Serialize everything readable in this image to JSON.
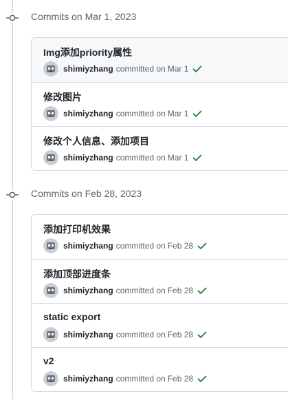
{
  "groups": [
    {
      "title": "Commits on Mar 1, 2023",
      "commits": [
        {
          "title": "Img添加priority属性",
          "author": "shimiyzhang",
          "verb": "committed on",
          "date": "Mar 1"
        },
        {
          "title": "修改图片",
          "author": "shimiyzhang",
          "verb": "committed on",
          "date": "Mar 1"
        },
        {
          "title": "修改个人信息、添加项目",
          "author": "shimiyzhang",
          "verb": "committed on",
          "date": "Mar 1"
        }
      ]
    },
    {
      "title": "Commits on Feb 28, 2023",
      "commits": [
        {
          "title": "添加打印机效果",
          "author": "shimiyzhang",
          "verb": "committed on",
          "date": "Feb 28"
        },
        {
          "title": "添加顶部进度条",
          "author": "shimiyzhang",
          "verb": "committed on",
          "date": "Feb 28"
        },
        {
          "title": "static export",
          "author": "shimiyzhang",
          "verb": "committed on",
          "date": "Feb 28"
        },
        {
          "title": "v2",
          "author": "shimiyzhang",
          "verb": "committed on",
          "date": "Feb 28"
        }
      ]
    }
  ],
  "colors": {
    "success_check": "#1a7f37",
    "timeline": "#d8dee4",
    "border": "#d1d9e0",
    "muted_text": "#59636e"
  },
  "icons": {
    "group_marker": "git-commit-icon",
    "status": "check-icon",
    "avatar": "user-avatar"
  }
}
